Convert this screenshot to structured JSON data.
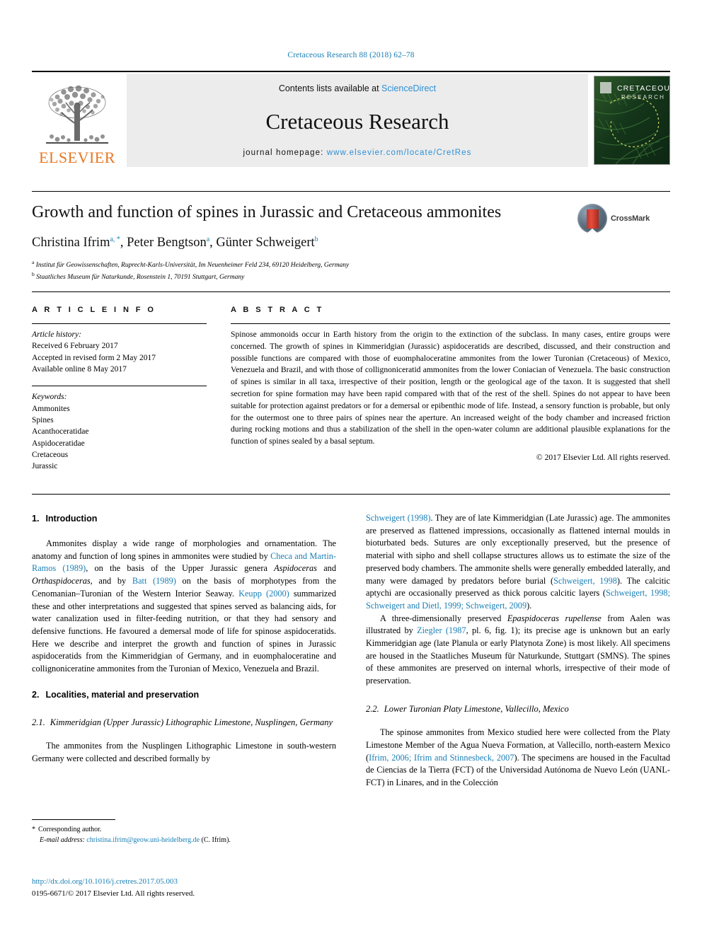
{
  "running_head": "Cretaceous Research 88 (2018) 62–78",
  "masthead": {
    "publisher": "ELSEVIER",
    "contents_prefix": "Contents lists available at ",
    "contents_link": "ScienceDirect",
    "journal_name": "Cretaceous Research",
    "homepage_prefix": "journal homepage: ",
    "homepage_url": "www.elsevier.com/locate/CretRes",
    "cover_title_line1": "CRETACEOUS",
    "cover_title_line2": "RESEARCH",
    "colors": {
      "link": "#2d8fd5",
      "elsevier_orange": "#e87722",
      "band_bg": "#ececec"
    }
  },
  "title": "Growth and function of spines in Jurassic and Cretaceous ammonites",
  "crossmark_label": "CrossMark",
  "authors": [
    {
      "name": "Christina Ifrim",
      "marks": "a, *"
    },
    {
      "name": "Peter Bengtson",
      "marks": "a"
    },
    {
      "name": "Günter Schweigert",
      "marks": "b"
    }
  ],
  "affiliations": [
    {
      "mark": "a",
      "text": "Institut für Geowissenschaften, Ruprecht-Karls-Universität, Im Neuenheimer Feld 234, 69120 Heidelberg, Germany"
    },
    {
      "mark": "b",
      "text": "Staatliches Museum für Naturkunde, Rosenstein 1, 70191 Stuttgart, Germany"
    }
  ],
  "article_info": {
    "heading": "A R T I C L E   I N F O",
    "history_label": "Article history:",
    "history": [
      "Received 6 February 2017",
      "Accepted in revised form 2 May 2017",
      "Available online 8 May 2017"
    ],
    "keywords_label": "Keywords:",
    "keywords": [
      "Ammonites",
      "Spines",
      "Acanthoceratidae",
      "Aspidoceratidae",
      "Cretaceous",
      "Jurassic"
    ]
  },
  "abstract": {
    "heading": "A B S T R A C T",
    "text": "Spinose ammonoids occur in Earth history from the origin to the extinction of the subclass. In many cases, entire groups were concerned. The growth of spines in Kimmeridgian (Jurassic) aspidoceratids are described, discussed, and their construction and possible functions are compared with those of euomphaloceratine ammonites from the lower Turonian (Cretaceous) of Mexico, Venezuela and Brazil, and with those of collignoniceratid ammonites from the lower Coniacian of Venezuela. The basic construction of spines is similar in all taxa, irrespective of their position, length or the geological age of the taxon. It is suggested that shell secretion for spine formation may have been rapid compared with that of the rest of the shell. Spines do not appear to have been suitable for protection against predators or for a demersal or epibenthic mode of life. Instead, a sensory function is probable, but only for the outermost one to three pairs of spines near the aperture. An increased weight of the body chamber and increased friction during rocking motions and thus a stabilization of the shell in the open-water column are additional plausible explanations for the function of spines sealed by a basal septum.",
    "copyright": "© 2017 Elsevier Ltd. All rights reserved."
  },
  "body": {
    "left": {
      "section1_num": "1.",
      "section1_title": "Introduction",
      "para1_a": "Ammonites display a wide range of morphologies and ornamentation. The anatomy and function of long spines in ammonites were studied by ",
      "para1_ref1": "Checa and Martin-Ramos (1989)",
      "para1_b": ", on the basis of the Upper Jurassic genera ",
      "para1_it1": "Aspidoceras",
      "para1_c": " and ",
      "para1_it2": "Orthaspidoceras",
      "para1_d": ", and by ",
      "para1_ref2": "Batt (1989)",
      "para1_e": " on the basis of morphotypes from the Cenomanian–Turonian of the Western Interior Seaway. ",
      "para1_ref3": "Keupp (2000)",
      "para1_f": " summarized these and other interpretations and suggested that spines served as balancing aids, for water canalization used in filter-feeding nutrition, or that they had sensory and defensive functions. He favoured a demersal mode of life for spinose aspidoceratids. Here we describe and interpret the growth and function of spines in Jurassic aspidoceratids from the Kimmeridgian of Germany, and in euomphaloceratine and collignoniceratine ammonites from the Turonian of Mexico, Venezuela and Brazil.",
      "section2_num": "2.",
      "section2_title": "Localities, material and preservation",
      "section21_num": "2.1.",
      "section21_title": "Kimmeridgian (Upper Jurassic) Lithographic Limestone, Nusplingen, Germany",
      "para2": "The ammonites from the Nusplingen Lithographic Limestone in south-western Germany were collected and described formally by"
    },
    "right": {
      "para3_ref1": "Schweigert (1998)",
      "para3_a": ". They are of late Kimmeridgian (Late Jurassic) age. The ammonites are preserved as flattened impressions, occasionally as flattened internal moulds in bioturbated beds. Sutures are only exceptionally preserved, but the presence of material with sipho and shell collapse structures allows us to estimate the size of the preserved body chambers. The ammonite shells were generally embedded laterally, and many were damaged by predators before burial (",
      "para3_ref2": "Schweigert, 1998",
      "para3_b": "). The calcitic aptychi are occasionally preserved as thick porous calcitic layers (",
      "para3_ref3": "Schweigert, 1998; Schweigert and Dietl, 1999; Schweigert, 2009",
      "para3_c": ").",
      "para4_a": "A three-dimensionally preserved ",
      "para4_it1": "Epaspidoceras rupellense",
      "para4_b": " from Aalen was illustrated by ",
      "para4_ref1": "Ziegler (1987",
      "para4_c": ", pl. 6, fig. 1); its precise age is unknown but an early Kimmeridgian age (late Planula or early Platynota Zone) is most likely. All specimens are housed in the Staatliches Museum für Naturkunde, Stuttgart (SMNS). The spines of these ammonites are preserved on internal whorls, irrespective of their mode of preservation.",
      "section22_num": "2.2.",
      "section22_title": "Lower Turonian Platy Limestone, Vallecillo, Mexico",
      "para5_a": "The spinose ammonites from Mexico studied here were collected from the Platy Limestone Member of the Agua Nueva Formation, at Vallecillo, north-eastern Mexico (",
      "para5_ref1": "Ifrim, 2006; Ifrim and Stinnesbeck, 2007",
      "para5_b": "). The specimens are housed in the Facultad de Ciencias de la Tierra (FCT) of the Universidad Autónoma de Nuevo León (UANL-FCT) in Linares, and in the Colección"
    }
  },
  "footer": {
    "corresponding_star": "*",
    "corresponding_label": "Corresponding author.",
    "email_label": "E-mail address:",
    "email": "christina.ifrim@geow.uni-heidelberg.de",
    "email_suffix": "(C. Ifrim).",
    "doi": "http://dx.doi.org/10.1016/j.cretres.2017.05.003",
    "issn_line": "0195-6671/© 2017 Elsevier Ltd. All rights reserved."
  }
}
